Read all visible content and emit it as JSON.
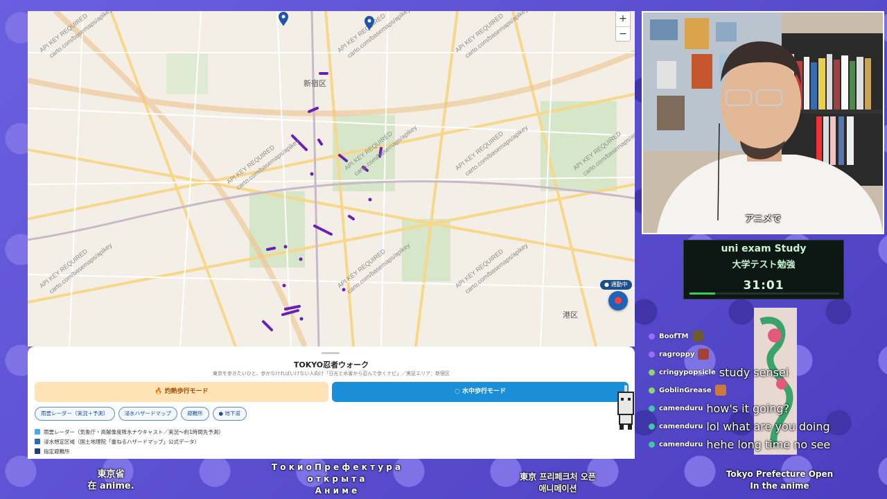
{
  "map": {
    "zoom_in": "+",
    "zoom_out": "−",
    "district_shinjuku": "新宿区",
    "district_minato": "港区",
    "watermark_line1": "API KEY REQUIRED",
    "watermark_line2": "carto.com/basemaps/apikey",
    "walking_badge": "● 通勤中",
    "locate_icon": "map-pin-icon"
  },
  "sheet": {
    "title": "TOKYO忍者ウォーク",
    "subtitle": "東京を歩きたいひと、歩かなければいけない人向け「日光と水害から忍んで歩くナビ」／実証エリア：新宿区",
    "heat_mode": "🔥 灼熱歩行モード",
    "water_mode": "◌ 水中歩行モード",
    "chips": [
      "雨雲レーダー（実況＋予測）",
      "浸水ハザードマップ",
      "避難所",
      "● 地下道"
    ],
    "legend": [
      {
        "label": "雨雲レーダー（気象庁・高解像度降水ナウキャスト／実況〜約1時間先予測）",
        "color": "#4aa8e8"
      },
      {
        "label": "浸水想定区域（国土地理院「重ねるハザードマップ」公式データ）",
        "color": "#2b6cb8"
      },
      {
        "label": "指定避難所",
        "color": "#1c3f7a"
      }
    ]
  },
  "cam": {
    "caption": "アニメで"
  },
  "timer": {
    "title": "uni exam Study",
    "subtitle": "大学テスト勉強",
    "value": "31:01",
    "progress": 0.17
  },
  "chat": [
    {
      "user": "BoofTM",
      "message": "",
      "badge_color": "#9a6cff",
      "emote": true
    },
    {
      "user": "ragroppy",
      "message": "",
      "badge_color": "#9a6cff",
      "emote": true
    },
    {
      "user": "cringypopsicle",
      "message": "study sensei",
      "badge_color": "#8bd86a",
      "emote": false
    },
    {
      "user": "GoblinGrease",
      "message": "",
      "badge_color": "#8bd86a",
      "emote": true
    },
    {
      "user": "camenduru",
      "message": "how's it going?",
      "badge_color": "#3fc7a8",
      "emote": false
    },
    {
      "user": "camenduru",
      "message": "lol what are you doing",
      "badge_color": "#3fc7a8",
      "emote": false
    },
    {
      "user": "camenduru",
      "message": "hehe long time no see",
      "badge_color": "#3fc7a8",
      "emote": false
    }
  ],
  "subtitles": {
    "chinese_1": "東京省",
    "chinese_2": "在 anime.",
    "russian_1": "Т о к и о  П р е ф е к т у р а",
    "russian_2": "о т к р ы т а",
    "russian_3": "А н и м е",
    "korean_1": "東京 프리페크처 오픈",
    "korean_2": "애니메이션",
    "english_1": "Tokyo Prefecture Open",
    "english_2": "In the anime"
  }
}
